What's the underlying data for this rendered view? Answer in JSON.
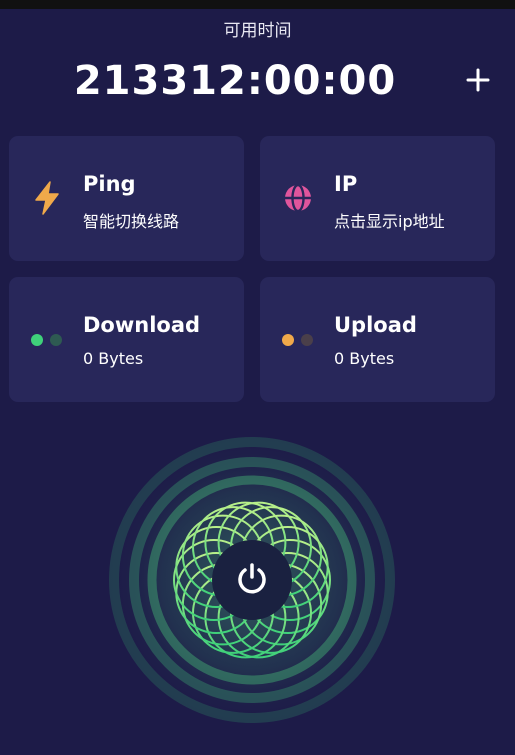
{
  "header": {
    "time_label": "可用时间",
    "time_value": "213312:00:00",
    "add_icon": "plus-icon"
  },
  "cards": {
    "ping": {
      "title": "Ping",
      "subtitle": "智能切换线路",
      "icon": "lightning-icon",
      "icon_color": "#f0a94a"
    },
    "ip": {
      "title": "IP",
      "subtitle": "点击显示ip地址",
      "icon": "globe-icon",
      "icon_color": "#e0559c"
    },
    "download": {
      "title": "Download",
      "subtitle": "0 Bytes",
      "icon": "dots-icon",
      "dot_colors": [
        "#3fd17a",
        "#2e5a52"
      ]
    },
    "upload": {
      "title": "Upload",
      "subtitle": "0 Bytes",
      "icon": "dots-icon",
      "dot_colors": [
        "#f0a94a",
        "#4a3f4a"
      ]
    }
  },
  "power": {
    "icon": "power-icon",
    "ring_color": "#5de08a"
  },
  "colors": {
    "background": "#1d1b48",
    "card": "#28275a"
  }
}
